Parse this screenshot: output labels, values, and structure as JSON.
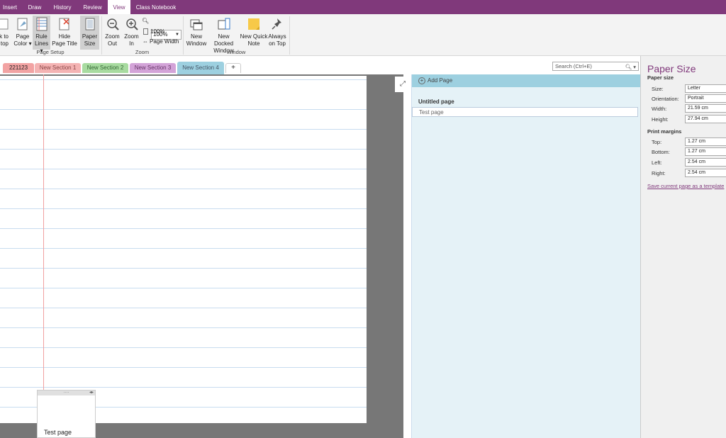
{
  "ribbon_tabs": [
    "Insert",
    "Draw",
    "History",
    "Review",
    "View",
    "Class Notebook"
  ],
  "ribbon": {
    "cut_label_1": "k to",
    "cut_label_2": "top",
    "page_color_1": "Page",
    "page_color_2": "Color",
    "rule_lines_1": "Rule",
    "rule_lines_2": "Lines",
    "hide_title_1": "Hide",
    "hide_title_2": "Page Title",
    "paper_size_1": "Paper",
    "paper_size_2": "Size",
    "group_page_setup": "Page Setup",
    "zoom_out_1": "Zoom",
    "zoom_out_2": "Out",
    "zoom_in_1": "Zoom",
    "zoom_in_2": "In",
    "zoom_value": "100%",
    "zoom_100": "100%",
    "page_width": "Page Width",
    "group_zoom": "Zoom",
    "new_window_1": "New",
    "new_window_2": "Window",
    "new_docked_1": "New Docked",
    "new_docked_2": "Window",
    "quick_note_1": "New Quick",
    "quick_note_2": "Note",
    "always_top_1": "Always",
    "always_top_2": "on Top",
    "group_window": "Window"
  },
  "sections": [
    "221123",
    "New Section 1",
    "New Section 2",
    "New Section 3",
    "New Section 4"
  ],
  "add_section": "+",
  "search_placeholder": "Search (Ctrl+E)",
  "note": {
    "title": "Test page"
  },
  "pages": {
    "add_page": "Add Page",
    "items": [
      "Untitled page",
      "Test page"
    ]
  },
  "paper_panel": {
    "title": "Paper Size",
    "paper_size_heading": "Paper size",
    "size_label": "Size:",
    "size_value": "Letter",
    "orientation_label": "Orientation:",
    "orientation_value": "Portrait",
    "width_label": "Width:",
    "width_value": "21.59 cm",
    "height_label": "Height:",
    "height_value": "27.94 cm",
    "margins_heading": "Print margins",
    "top_label": "Top:",
    "top_value": "1.27 cm",
    "bottom_label": "Bottom:",
    "bottom_value": "1.27 cm",
    "left_label": "Left:",
    "left_value": "2.54 cm",
    "right_label": "Right:",
    "right_value": "2.54 cm",
    "save_template": "Save current page as a template"
  },
  "colors": {
    "accent": "#80397b",
    "page_list": "#e5f2f7"
  }
}
